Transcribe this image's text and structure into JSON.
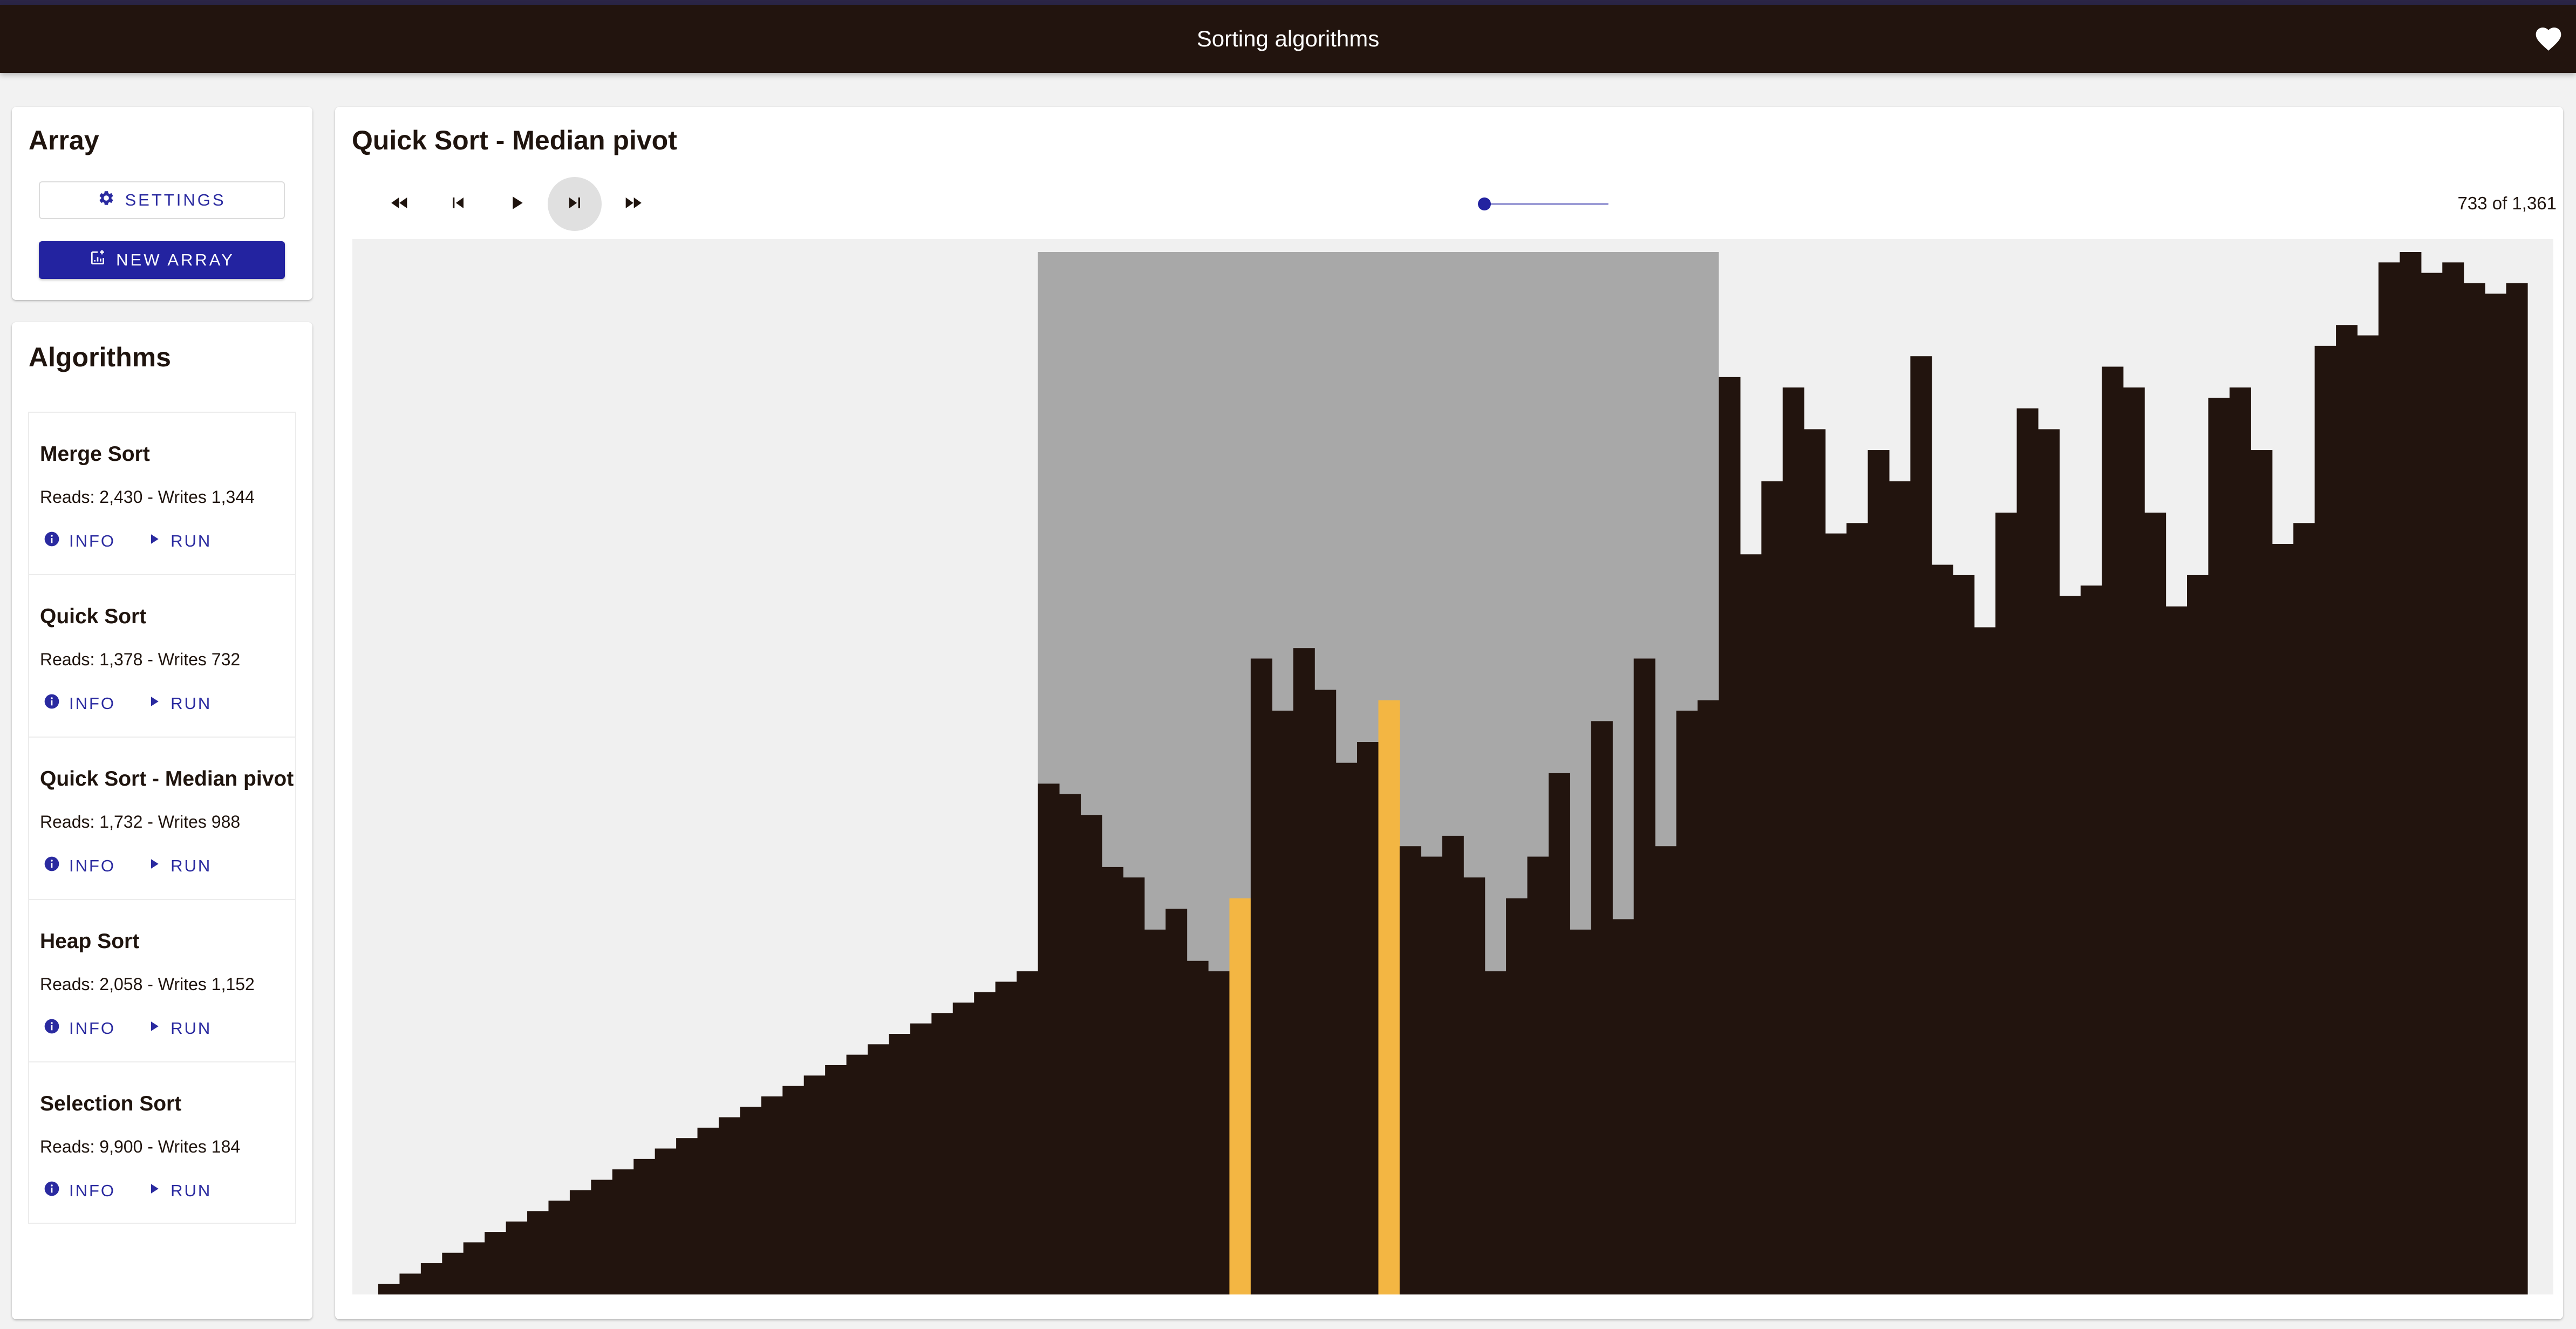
{
  "app": {
    "title": "Sorting algorithms"
  },
  "array_panel": {
    "title": "Array",
    "settings_label": "SETTINGS",
    "new_array_label": "NEW ARRAY"
  },
  "algorithms_panel": {
    "title": "Algorithms",
    "items": [
      {
        "name": "Merge Sort",
        "stats": "Reads: 2,430 - Writes 1,344",
        "info_label": "INFO",
        "run_label": "RUN"
      },
      {
        "name": "Quick Sort",
        "stats": "Reads: 1,378 - Writes 732",
        "info_label": "INFO",
        "run_label": "RUN"
      },
      {
        "name": "Quick Sort - Median pivot",
        "stats": "Reads: 1,732 - Writes 988",
        "info_label": "INFO",
        "run_label": "RUN"
      },
      {
        "name": "Heap Sort",
        "stats": "Reads: 2,058 - Writes 1,152",
        "info_label": "INFO",
        "run_label": "RUN"
      },
      {
        "name": "Selection Sort",
        "stats": "Reads: 9,900 - Writes 184",
        "info_label": "INFO",
        "run_label": "RUN"
      }
    ]
  },
  "visualizer": {
    "title": "Quick Sort - Median pivot",
    "step_counter": "733 of 1,361",
    "speed_fraction": 0.0,
    "icons": {
      "rewind": "fast-rewind-icon",
      "prev": "skip-previous-icon",
      "play": "play-icon",
      "next": "skip-next-icon",
      "forward": "fast-forward-icon"
    }
  },
  "chart_data": {
    "type": "bar",
    "values": [
      1,
      2,
      3,
      4,
      5,
      6,
      7,
      8,
      9,
      10,
      11,
      12,
      13,
      14,
      15,
      16,
      17,
      18,
      19,
      20,
      21,
      22,
      23,
      24,
      25,
      26,
      27,
      28,
      29,
      30,
      31,
      49,
      48,
      46,
      41,
      40,
      35,
      37,
      32,
      31,
      38,
      61,
      56,
      62,
      58,
      51,
      53,
      57,
      43,
      42,
      44,
      40,
      31,
      38,
      42,
      50,
      35,
      55,
      36,
      61,
      43,
      56,
      57,
      88,
      71,
      78,
      87,
      83,
      73,
      74,
      81,
      78,
      90,
      70,
      69,
      64,
      75,
      85,
      83,
      67,
      68,
      89,
      87,
      75,
      66,
      69,
      86,
      87,
      81,
      72,
      74,
      91,
      93,
      92,
      99,
      100,
      98,
      99,
      97,
      96,
      97
    ],
    "highlight_indices": [
      40,
      47
    ],
    "highlight_color": "#f3b643",
    "bar_color": "#22140e",
    "range_start": 31,
    "range_end": 63,
    "range_color": "#a8a8a8",
    "background_color": "#f0f0f0",
    "ylim": [
      0,
      100
    ]
  },
  "colors": {
    "appbar": "#22140e",
    "accent": "#2323a0",
    "text": "#1f140e"
  }
}
